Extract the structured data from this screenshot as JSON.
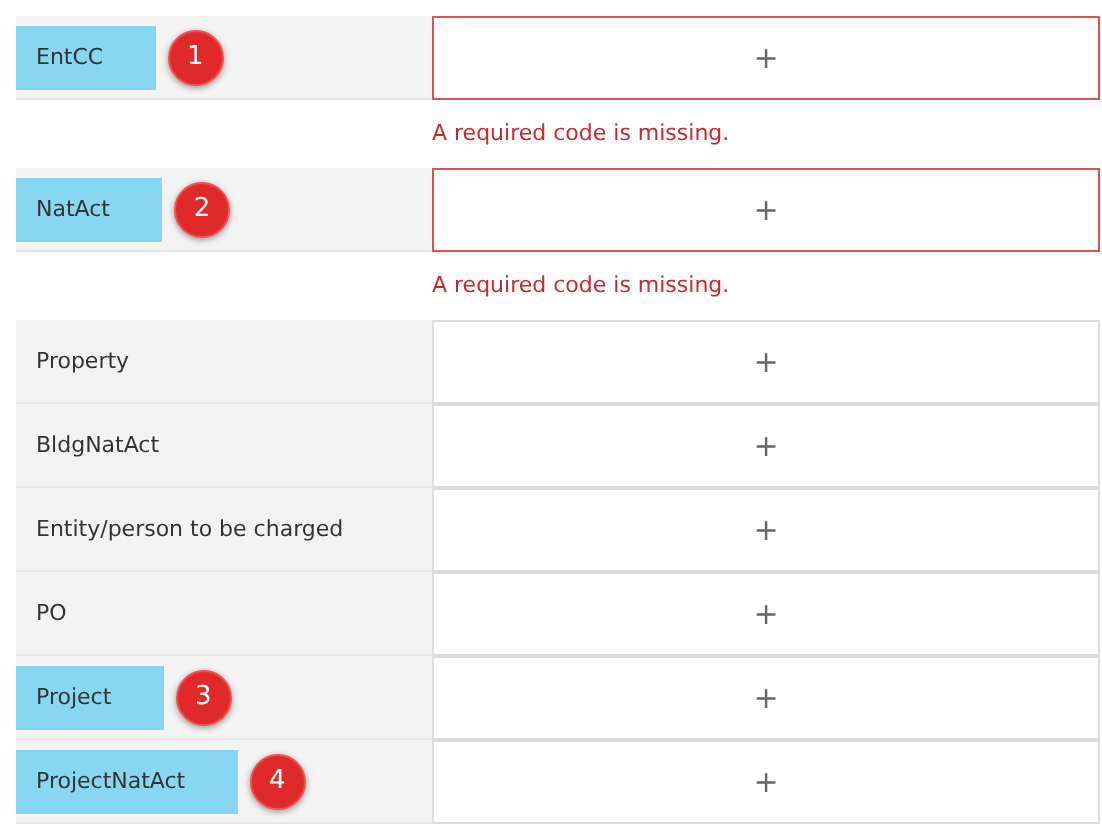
{
  "fields": [
    {
      "label": "EntCC",
      "highlighted": true,
      "badge": "1",
      "invalid": true,
      "add": "+",
      "error": "A required code is missing."
    },
    {
      "label": "NatAct",
      "highlighted": true,
      "badge": "2",
      "invalid": true,
      "add": "+",
      "error": "A required code is missing."
    },
    {
      "label": "Property",
      "highlighted": false,
      "invalid": false,
      "add": "+"
    },
    {
      "label": "BldgNatAct",
      "highlighted": false,
      "invalid": false,
      "add": "+"
    },
    {
      "label": "Entity/person to be charged",
      "highlighted": false,
      "invalid": false,
      "add": "+"
    },
    {
      "label": "PO",
      "highlighted": false,
      "invalid": false,
      "add": "+"
    },
    {
      "label": "Project",
      "highlighted": true,
      "badge": "3",
      "invalid": false,
      "add": "+"
    },
    {
      "label": "ProjectNatAct",
      "highlighted": true,
      "badge": "4",
      "invalid": false,
      "add": "+"
    }
  ]
}
